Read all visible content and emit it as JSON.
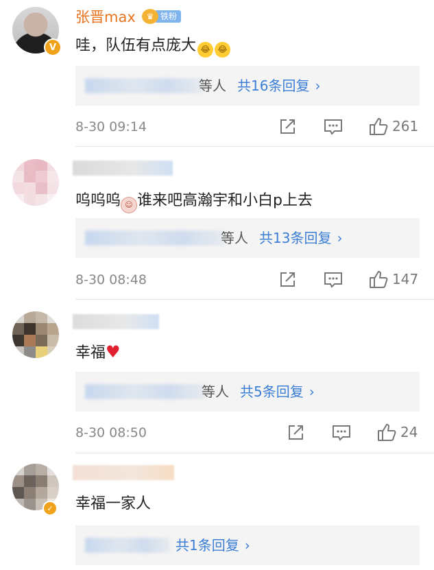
{
  "comments": [
    {
      "username": "张晋max",
      "fan_badge": "铁粉",
      "verified_badge": "V",
      "text": "哇，队伍有点庞大",
      "emojis": [
        "laugh-cry-emoji",
        "laugh-cry-emoji"
      ],
      "reply_suffix": "等人",
      "reply_link": "共16条回复",
      "time": "8-30 09:14",
      "likes": "261"
    },
    {
      "text_before": "呜呜呜",
      "text_after": "谁来吧高瀚宇和小白p上去",
      "emoji": "baby-face-emoji",
      "reply_suffix": "等人",
      "reply_link": "共13条回复",
      "time": "8-30 08:48",
      "likes": "147"
    },
    {
      "text": "幸福",
      "emoji": "red-heart-emoji",
      "reply_suffix": "等人",
      "reply_link": "共5条回复",
      "time": "8-30 08:50",
      "likes": "24"
    },
    {
      "text": "幸福一家人",
      "reply_link": "共1条回复"
    }
  ],
  "colors": {
    "username": "#e8731f",
    "link": "#3b7ed6",
    "text": "#222222",
    "muted": "#888888",
    "reply_bg": "#f4f4f4"
  }
}
